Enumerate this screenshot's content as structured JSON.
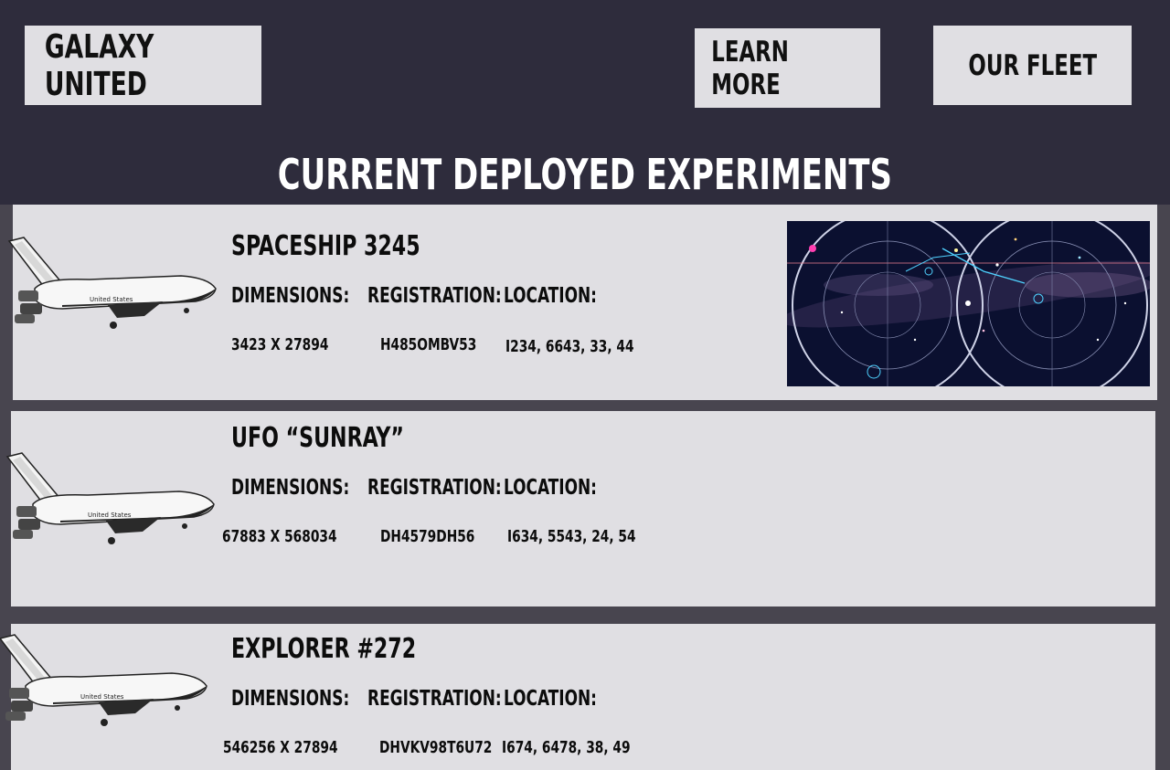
{
  "header": {
    "brand": "GALAXY UNITED",
    "nav": {
      "learn_more": "LEARN MORE",
      "our_fleet": "OUR FLEET"
    },
    "page_title": "CURRENT DEPLOYED EXPERIMENTS"
  },
  "labels": {
    "dimensions": "DIMENSIONS:",
    "registration": "REGISTRATION:",
    "location": "LOCATION:"
  },
  "experiments": [
    {
      "name": "SPACESHIP 3245",
      "dimensions": "3423 X 27894",
      "registration": "H485OMBV53",
      "location": "I234, 6643, 33, 44",
      "image": "shuttle-icon",
      "extra_image": "star-map-image"
    },
    {
      "name": "UFO “SUNRAY”",
      "dimensions": "67883 X 568034",
      "registration": "DH4579DH56",
      "location": "I634, 5543, 24, 54",
      "image": "shuttle-icon"
    },
    {
      "name": "EXPLORER #272",
      "dimensions": "546256 X 27894",
      "registration": "DHVKV98T6U72",
      "location": "I674, 6478, 38, 49",
      "image": "shuttle-icon"
    }
  ],
  "colors": {
    "header_bg": "#2e2c3c",
    "page_bg": "#48454f",
    "card_bg": "#e0dfe3",
    "button_bg": "#e0dfe3",
    "text_dark": "#0c0c0c",
    "title_text": "#ffffff"
  }
}
